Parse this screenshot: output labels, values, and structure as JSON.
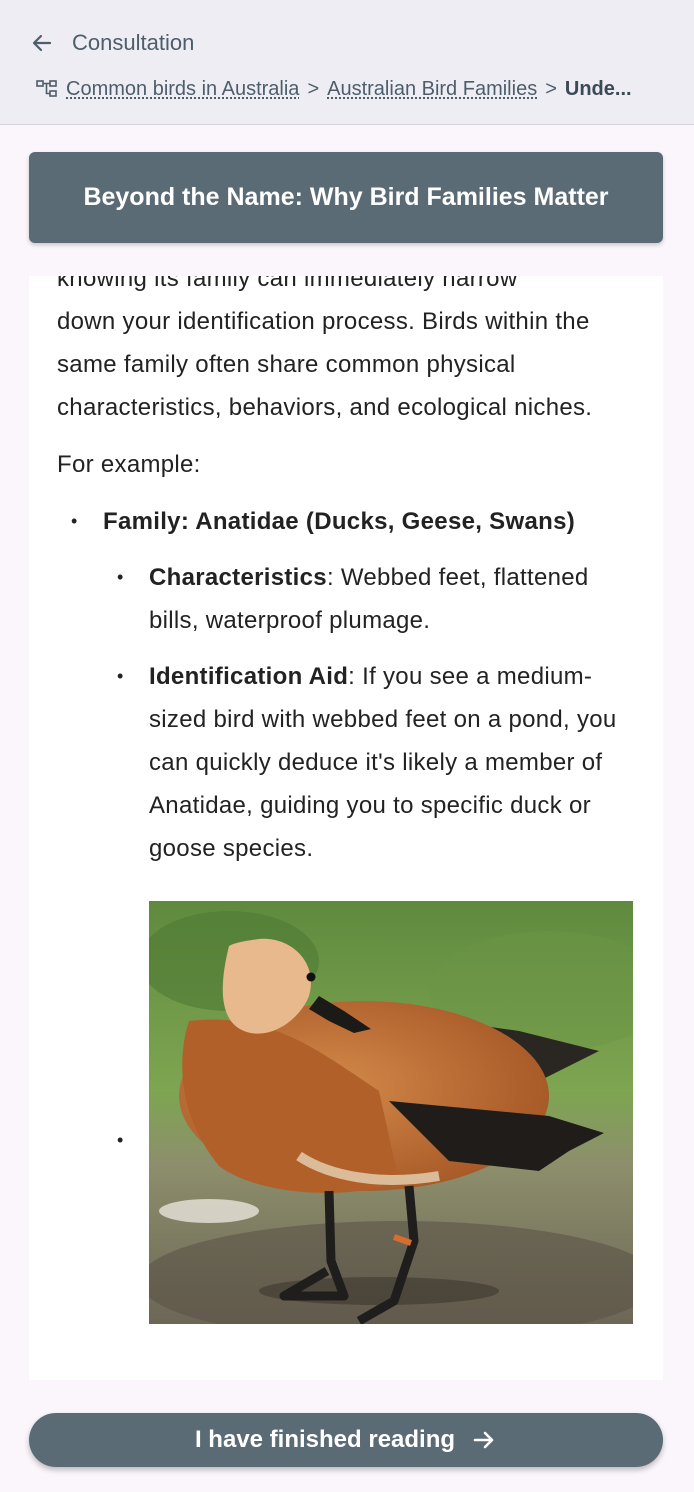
{
  "header": {
    "back_label": "Consultation",
    "breadcrumb": {
      "items": [
        "Common birds in Australia",
        "Australian Bird Families"
      ],
      "separator": ">",
      "current": "Unde..."
    }
  },
  "title_bar": {
    "title": "Beyond the Name: Why Bird Families Matter"
  },
  "content": {
    "partial_line": "knowing its family can immediately narrow",
    "paragraph": "down your identification process. Birds within the same family often share common physical characteristics, behaviors, and ecological niches.",
    "example_intro": "For example:",
    "family": {
      "heading": "Family: Anatidae (Ducks, Geese, Swans)",
      "items": [
        {
          "label": "Characteristics",
          "text": ": Webbed feet, flattened bills, waterproof plumage."
        },
        {
          "label": "Identification Aid",
          "text": ": If you see a medium-sized bird with webbed feet on a pond, you can quickly deduce it's likely a member of Anatidae, guiding you to specific duck or goose species."
        }
      ]
    }
  },
  "footer": {
    "finish_label": "I have finished reading"
  },
  "colors": {
    "accent": "#5a6b75",
    "header_bg": "#eeedf3",
    "page_bg": "#fbf6fc"
  }
}
